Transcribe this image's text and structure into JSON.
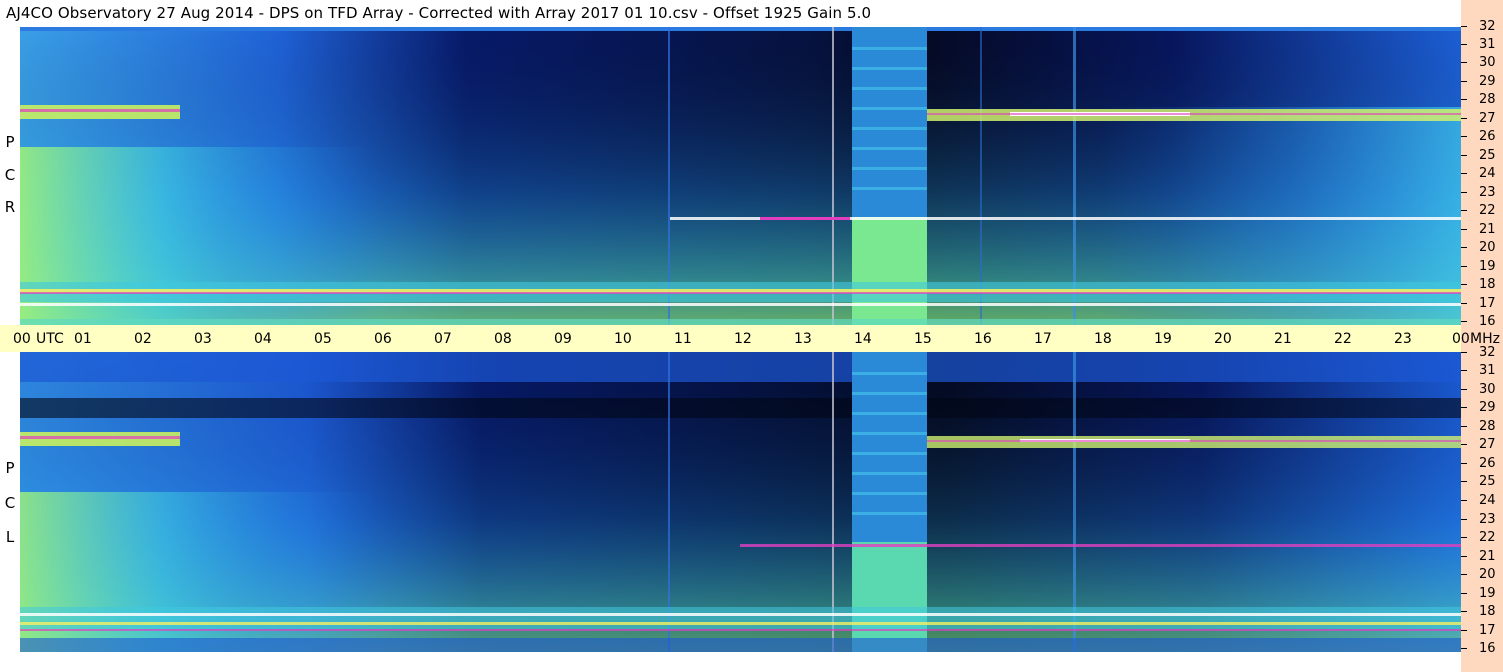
{
  "header": {
    "title": "AJ4CO Observatory  27 Aug 2014  -  DPS on TFD Array  -  Corrected with Array 2017 01 10.csv  -  Offset 1925  Gain 5.0"
  },
  "top_panel": {
    "polarization_letters": [
      "R",
      "C",
      "P"
    ]
  },
  "bottom_panel": {
    "polarization_letters": [
      "L",
      "C",
      "P"
    ]
  },
  "time_axis": {
    "labels": [
      "00",
      "UTC",
      "01",
      "02",
      "03",
      "04",
      "05",
      "06",
      "07",
      "08",
      "09",
      "10",
      "11",
      "12",
      "13",
      "14",
      "15",
      "16",
      "17",
      "18",
      "19",
      "20",
      "21",
      "22",
      "23",
      "00",
      "MHz"
    ]
  },
  "frequency_axis": {
    "labels": [
      "32",
      "31",
      "30",
      "29",
      "28",
      "27",
      "26",
      "25",
      "24",
      "23",
      "22",
      "21",
      "20",
      "19",
      "18",
      "17",
      "16"
    ]
  },
  "colors": {
    "background": "#ffffff",
    "utc_bar": "#ffffc4",
    "right_strip": "#ffd9bf",
    "spectrogram_dark": "#000a3a",
    "spectrogram_blue": "#1a4fd0",
    "spectrogram_cyan": "#20c8e0",
    "spectrogram_green": "#9cf07a",
    "spectrogram_yellow": "#f8f060",
    "spectrogram_magenta": "#e040c0"
  }
}
